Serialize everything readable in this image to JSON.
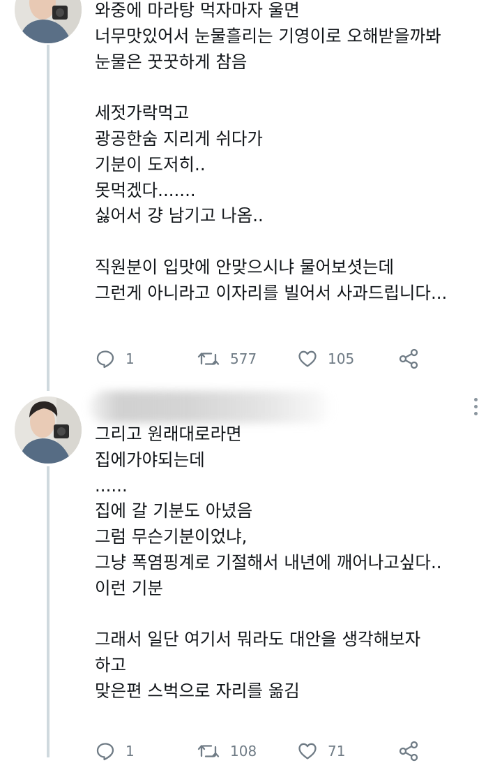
{
  "tweets": [
    {
      "author": {
        "avatar": "profile-photo"
      },
      "lines": [
        "와중에 마라탕 먹자마자 울면",
        "너무맛있어서 눈물흘리는 기영이로 오해받을까봐",
        "눈물은 꿋꿋하게 참음",
        "",
        "세젓가락먹고",
        "광공한숨 지리게 쉬다가",
        "기분이 도저히..",
        "못먹겠다.......",
        "싫어서 걍 남기고 나옴..",
        "",
        "직원분이 입맛에 안맞으시냐 물어보셧는데",
        "그런게 아니라고 이자리를 빌어서 사과드립니다..."
      ],
      "actions": {
        "reply": {
          "icon": "reply-icon",
          "count": "1"
        },
        "retweet": {
          "icon": "retweet-icon",
          "count": "577"
        },
        "like": {
          "icon": "heart-icon",
          "count": "105"
        },
        "share": {
          "icon": "share-icon"
        }
      }
    },
    {
      "author": {
        "avatar": "profile-photo",
        "name_hidden": true
      },
      "lines": [
        "그리고 원래대로라면",
        "집에가야되는데",
        "......",
        "집에 갈 기분도 아녔음",
        "그럼 무슨기분이었냐,",
        "그냥 폭염핑계로 기절해서 내년에 깨어나고싶다..",
        "이런 기분",
        "",
        "그래서 일단 여기서 뭐라도 대안을 생각해보자",
        "하고",
        "맞은편 스벅으로 자리를 옮김"
      ],
      "actions": {
        "reply": {
          "icon": "reply-icon",
          "count": "1"
        },
        "retweet": {
          "icon": "retweet-icon",
          "count": "108"
        },
        "like": {
          "icon": "heart-icon",
          "count": "71"
        },
        "share": {
          "icon": "share-icon"
        }
      }
    }
  ],
  "colors": {
    "text": "#101418",
    "muted": "#6f7b85",
    "thread_line": "#cfd9de"
  }
}
